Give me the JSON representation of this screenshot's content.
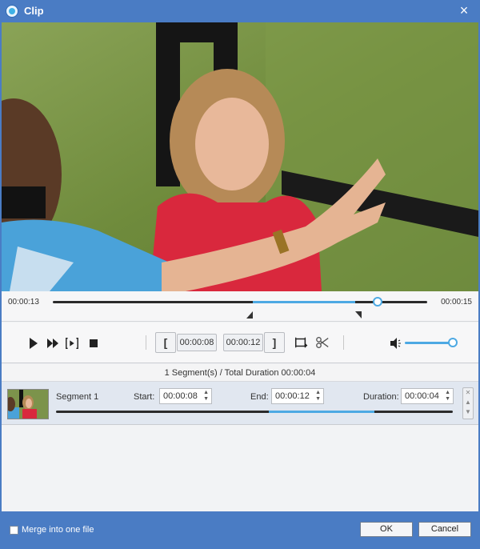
{
  "window": {
    "title": "Clip",
    "close_label": "×"
  },
  "timeline": {
    "current_time": "00:00:13",
    "total_time": "00:00:15"
  },
  "controls": {
    "start_time": "00:00:08",
    "end_time": "00:00:12",
    "start_bracket": "[",
    "end_bracket": "]",
    "volume_level": 1.0
  },
  "summary": "1 Segment(s) / Total Duration 00:00:04",
  "segments": [
    {
      "name": "Segment 1",
      "start_label": "Start:",
      "start": "00:00:08",
      "end_label": "End:",
      "end": "00:00:12",
      "duration_label": "Duration:",
      "duration": "00:00:04"
    }
  ],
  "footer": {
    "merge_label": "Merge into one file",
    "merge_checked": false,
    "ok_label": "OK",
    "cancel_label": "Cancel"
  },
  "colors": {
    "accent": "#4da9e3",
    "frame": "#4a7cc4"
  },
  "icons": {
    "play": "play-icon",
    "fast_forward": "fast-forward-icon",
    "frame_step": "frame-step-icon",
    "stop": "stop-icon",
    "crop": "crop-icon",
    "cut": "scissors-icon",
    "volume": "volume-icon",
    "app": "app-logo-icon",
    "close": "close-icon"
  }
}
